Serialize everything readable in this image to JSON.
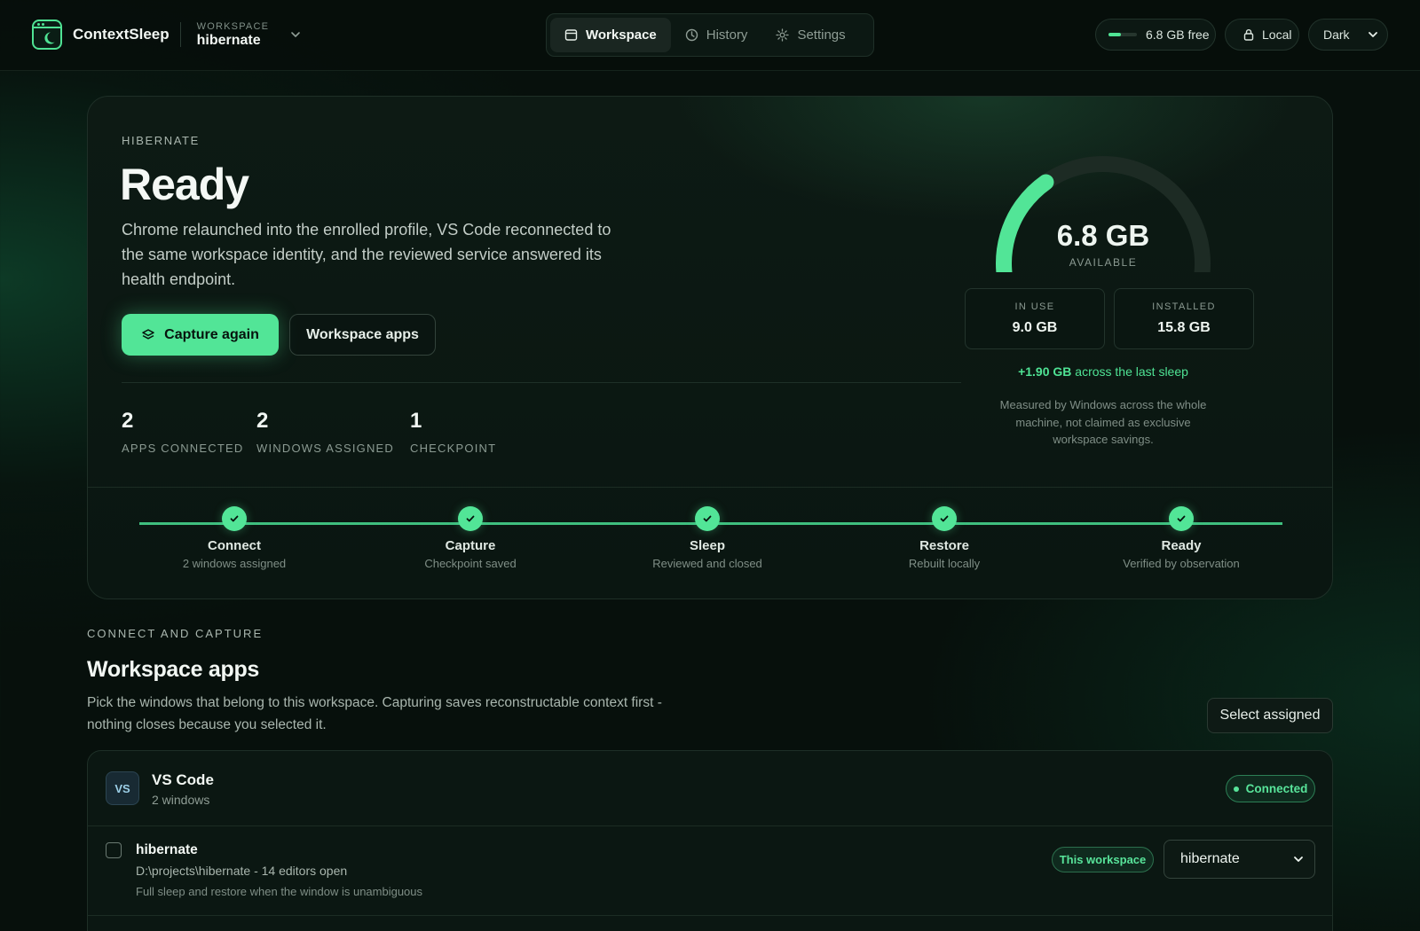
{
  "app": {
    "name": "ContextSleep"
  },
  "workspace": {
    "label": "WORKSPACE",
    "name": "hibernate"
  },
  "nav": {
    "tabs": [
      {
        "label": "Workspace",
        "icon": "window-icon",
        "active": true
      },
      {
        "label": "History",
        "icon": "clock-icon"
      },
      {
        "label": "Settings",
        "icon": "gear-icon"
      }
    ]
  },
  "status": {
    "memory_free": "6.8 GB free",
    "memory_free_fraction": 0.43,
    "local_label": "Local",
    "theme": "Dark"
  },
  "hero": {
    "eyebrow": "HIBERNATE",
    "title": "Ready",
    "description": "Chrome relaunched into the enrolled profile, VS Code reconnected to the same workspace identity, and the reviewed service answered its health endpoint.",
    "primary_button": "Capture again",
    "secondary_button": "Workspace apps",
    "stats": [
      {
        "value": "2",
        "label": "APPS CONNECTED"
      },
      {
        "value": "2",
        "label": "WINDOWS ASSIGNED"
      },
      {
        "value": "1",
        "label": "CHECKPOINT"
      }
    ]
  },
  "memory": {
    "available": "6.8 GB",
    "available_label": "AVAILABLE",
    "available_gb": 6.8,
    "installed_gb": 15.8,
    "in_use_label": "IN USE",
    "in_use": "9.0 GB",
    "installed_label": "INSTALLED",
    "installed": "15.8 GB",
    "delta_value": "+1.90 GB",
    "delta_text": "across the last sleep",
    "note": "Measured by Windows across the whole machine, not claimed as exclusive workspace savings."
  },
  "steps": [
    {
      "name": "Connect",
      "sub": "2 windows assigned",
      "done": true
    },
    {
      "name": "Capture",
      "sub": "Checkpoint saved",
      "done": true
    },
    {
      "name": "Sleep",
      "sub": "Reviewed and closed",
      "done": true
    },
    {
      "name": "Restore",
      "sub": "Rebuilt locally",
      "done": true
    },
    {
      "name": "Ready",
      "sub": "Verified by observation",
      "done": true
    }
  ],
  "apps_section": {
    "eyebrow": "CONNECT AND CAPTURE",
    "title": "Workspace apps",
    "description": "Pick the windows that belong to this workspace. Capturing saves reconstructable context first - nothing closes because you selected it.",
    "select_button": "Select assigned"
  },
  "apps": [
    {
      "icon_text": "VS",
      "name": "VS Code",
      "subtitle": "2 windows",
      "status": "Connected",
      "windows": [
        {
          "name": "hibernate",
          "path": "D:\\projects\\hibernate - 14 editors open",
          "note": "Full sleep and restore when the window is unambiguous",
          "badge": "This workspace",
          "assigned": "hibernate",
          "checked": false
        }
      ]
    }
  ]
}
